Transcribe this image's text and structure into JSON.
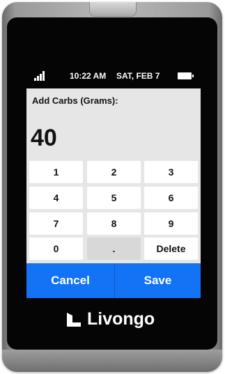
{
  "status": {
    "time": "10:22 AM",
    "date": "SAT, FEB 7"
  },
  "entry": {
    "prompt": "Add Carbs (Grams):",
    "value": "40"
  },
  "keypad": {
    "keys": [
      "1",
      "2",
      "3",
      "4",
      "5",
      "6",
      "7",
      "8",
      "9",
      "0",
      ".",
      "Delete"
    ]
  },
  "actions": {
    "cancel_label": "Cancel",
    "save_label": "Save"
  },
  "brand": {
    "name": "Livongo"
  },
  "colors": {
    "accent": "#1273f5",
    "screen_bg": "#e6e6e6",
    "key_bg": "#ffffff",
    "device_face": "#050505"
  },
  "icons": [
    "signal-strength-icon",
    "battery-icon",
    "livongo-logo-icon"
  ]
}
